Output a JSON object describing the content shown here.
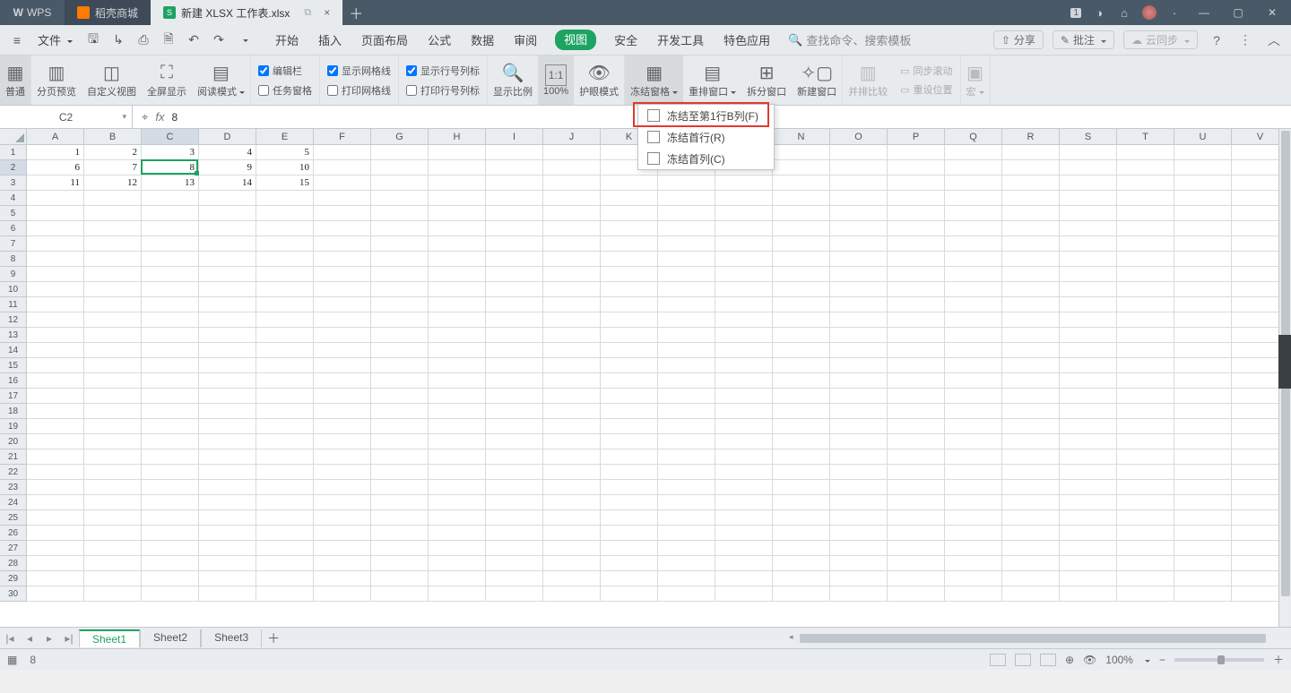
{
  "titlebar": {
    "app": "WPS",
    "mall": "稻壳商城",
    "doc": "新建 XLSX 工作表.xlsx",
    "badge": "1"
  },
  "menubar": {
    "file": "文件",
    "tabs": [
      "开始",
      "插入",
      "页面布局",
      "公式",
      "数据",
      "审阅",
      "视图",
      "安全",
      "开发工具",
      "特色应用"
    ],
    "activeTab": "视图",
    "search_placeholder": "查找命令、搜索模板",
    "share": "分享",
    "annotate": "批注",
    "cloud": "云同步"
  },
  "ribbon": {
    "items": [
      "普通",
      "分页预览",
      "自定义视图",
      "全屏显示",
      "阅读模式"
    ],
    "checks": {
      "editbar": "编辑栏",
      "taskpane": "任务窗格",
      "gridlines": "显示网格线",
      "printgrid": "打印网格线",
      "rowcol": "显示行号列标",
      "printrowcol": "打印行号列标"
    },
    "zoomgrp": [
      "显示比例",
      "100%",
      "护眼模式"
    ],
    "wingrp": [
      "冻结窗格",
      "重排窗口",
      "拆分窗口",
      "新建窗口",
      "并排比较"
    ],
    "syncscroll": "同步滚动",
    "resetpos": "重设位置",
    "macro": "宏"
  },
  "dropdown": {
    "freeze_to": "冻结至第1行B列(F)",
    "freeze_row": "冻结首行(R)",
    "freeze_col": "冻结首列(C)"
  },
  "formula": {
    "name": "C2",
    "value": "8"
  },
  "columns": [
    "A",
    "B",
    "C",
    "D",
    "E",
    "F",
    "G",
    "H",
    "I",
    "J",
    "K",
    "L",
    "M",
    "N",
    "O",
    "P",
    "Q",
    "R",
    "S",
    "T",
    "U",
    "V"
  ],
  "selectedCol": "C",
  "selectedRowIdx": 1,
  "rowCount": 30,
  "cells": [
    [
      "1",
      "2",
      "3",
      "4",
      "5"
    ],
    [
      "6",
      "7",
      "8",
      "9",
      "10"
    ],
    [
      "11",
      "12",
      "13",
      "14",
      "15"
    ]
  ],
  "sheets": {
    "list": [
      "Sheet1",
      "Sheet2",
      "Sheet3"
    ],
    "active": 0
  },
  "status": {
    "value": "8",
    "zoom": "100%"
  }
}
